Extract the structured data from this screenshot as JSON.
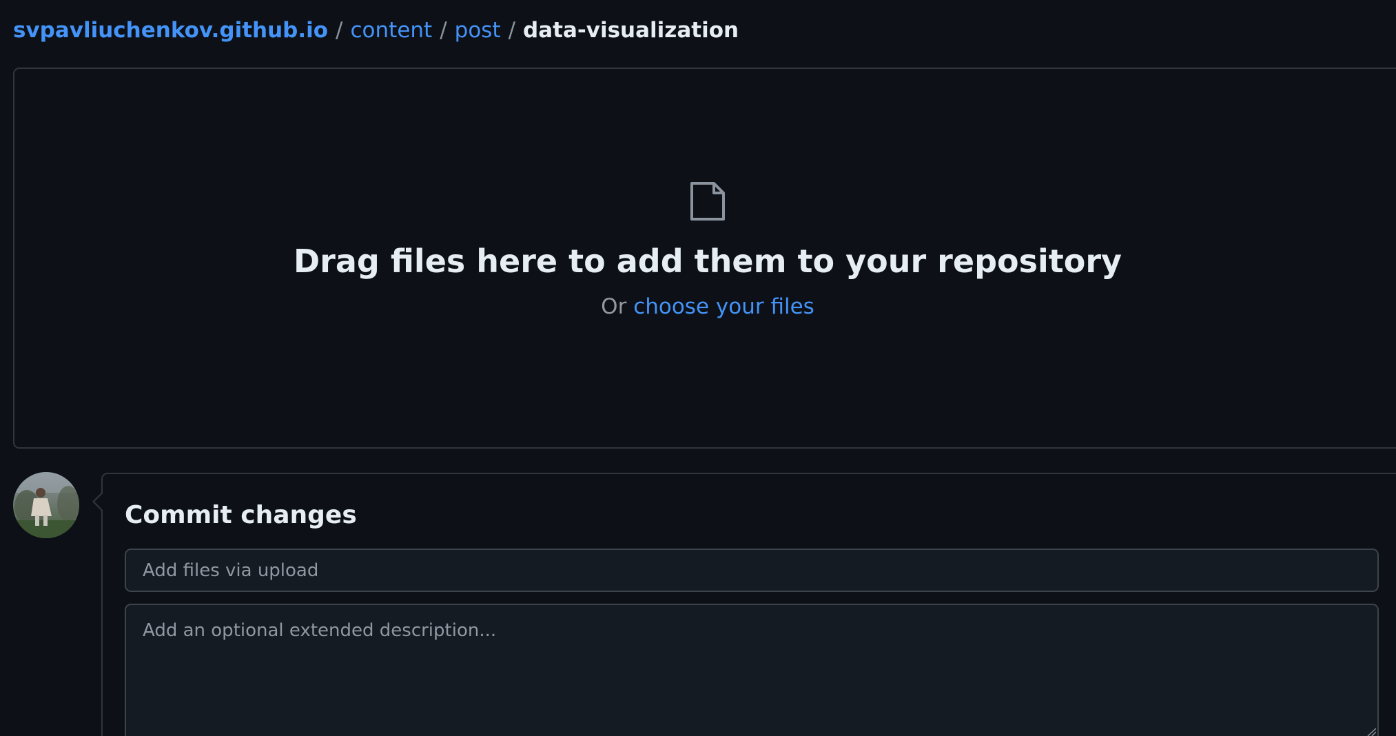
{
  "breadcrumb": {
    "root": "svpavliuchenkov.github.io",
    "separator": "/",
    "items": [
      "content",
      "post"
    ],
    "current": "data-visualization"
  },
  "dropzone": {
    "icon": "file-icon",
    "title": "Drag files here to add them to your repository",
    "or_text": "Or",
    "choose_link": "choose your files"
  },
  "commit": {
    "title": "Commit changes",
    "summary_placeholder": "Add files via upload",
    "description_placeholder": "Add an optional extended description..."
  },
  "colors": {
    "background": "#0d1117",
    "link": "#4493f8",
    "border": "#30363d",
    "input_bg": "#151b23"
  }
}
